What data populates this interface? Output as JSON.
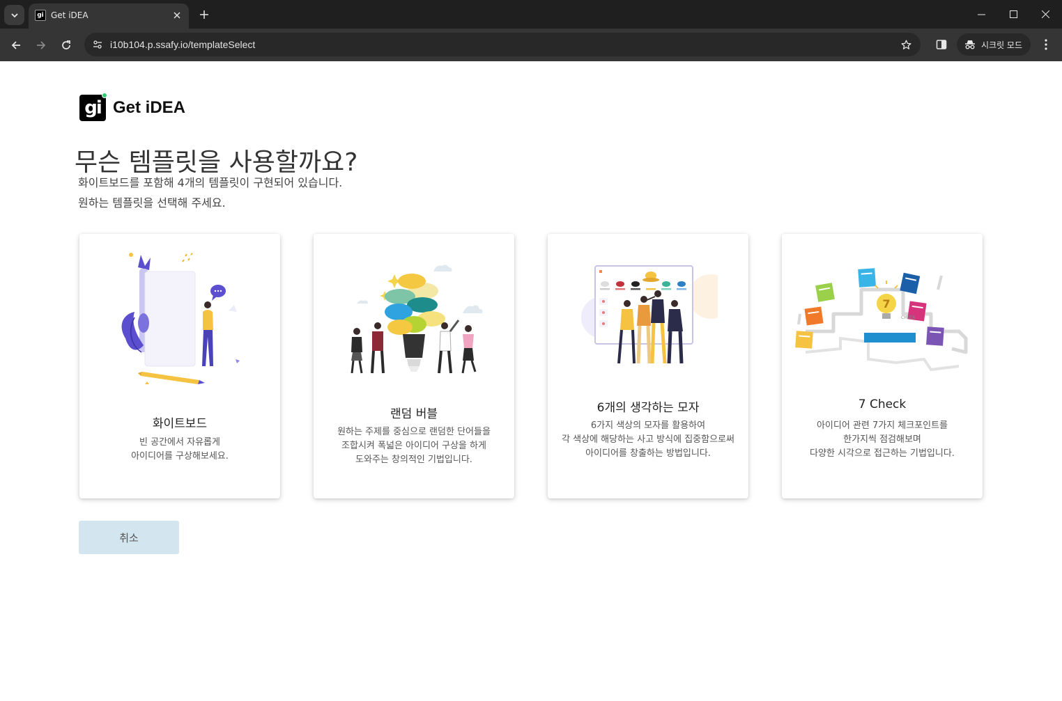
{
  "browser": {
    "tab_title": "Get iDEA",
    "url": "i10b104.p.ssafy.io/templateSelect",
    "incognito_label": "시크릿 모드"
  },
  "page": {
    "logo_text": "Get iDEA",
    "logo_mark": "gi",
    "heading": "무슨 템플릿을 사용할까요?",
    "subtext_line1": "화이트보드를 포함해 4개의 템플릿이 구현되어 있습니다.",
    "subtext_line2": "원하는 템플릿을 선택해 주세요.",
    "cancel_label": "취소"
  },
  "templates": [
    {
      "title": "화이트보드",
      "desc": [
        "빈 공간에서 자유롭게",
        "아이디어를 구상해보세요."
      ],
      "illustration": "whiteboard-illustration"
    },
    {
      "title": "랜덤 버블",
      "desc": [
        "원하는 주제를 중심으로 랜덤한 단어들을",
        "조합시켜 폭넓은 아이디어 구상을 하게",
        "도와주는 창의적인 기법입니다."
      ],
      "illustration": "random-bubble-illustration"
    },
    {
      "title": "6개의 생각하는 모자",
      "desc": [
        "6가지 색상의 모자를 활용하여",
        "각 색상에 해당하는 사고 방식에 집중함으로써",
        "아이디어를 창출하는 방법입니다."
      ],
      "illustration": "six-hats-illustration"
    },
    {
      "title": "7 Check",
      "desc": [
        "아이디어 관련 7가지 체크포인트를",
        "한가지씩 점검해보며",
        "다양한 시각으로 접근하는 기법입니다."
      ],
      "illustration": "seven-check-illustration",
      "check_label": "CHECK",
      "check_number": "7"
    }
  ],
  "colors": {
    "cancel_bg": "#d3e5ee",
    "chrome_dark": "#1f1f1f",
    "toolbar": "#353535"
  }
}
